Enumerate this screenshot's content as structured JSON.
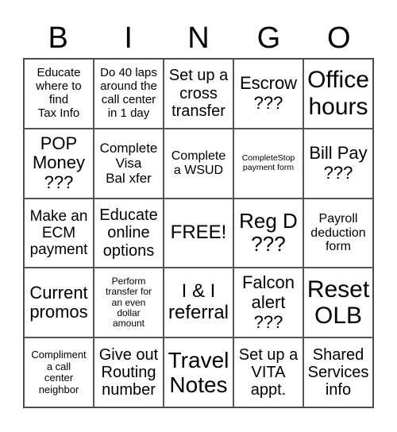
{
  "header": [
    "B",
    "I",
    "N",
    "G",
    "O"
  ],
  "cells": [
    "Educate\nwhere to\nfind\nTax Info",
    "Do 40 laps\naround the\ncall center\nin 1 day",
    "Set up a\ncross\ntransfer",
    "Escrow\n???",
    "Office\nhours",
    "POP\nMoney\n???",
    "Complete\nVisa\nBal xfer",
    "Complete\na WSUD",
    "CompleteStop\npayment form",
    "Bill Pay\n???",
    "Make an\nECM\npayment",
    "Educate\nonline\noptions",
    "FREE!",
    "Reg D\n???",
    "Payroll\ndeduction\nform",
    "Current\npromos",
    "Perform\ntransfer for\nan even\ndollar\namount",
    "I & I\nreferral",
    "Falcon\nalert\n???",
    "Reset\nOLB",
    "Compliment\na call\ncenter\nneighbor",
    "Give out\nRouting\nnumber",
    "Travel\nNotes",
    "Set up a\nVITA\nappt.",
    "Shared\nServices\ninfo"
  ]
}
